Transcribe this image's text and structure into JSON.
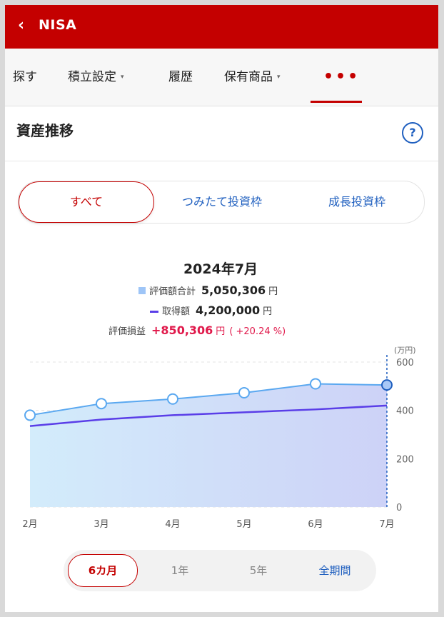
{
  "header": {
    "back_icon": "chevron-left-icon",
    "title": "NISA"
  },
  "nav": {
    "items": [
      {
        "label": "探す"
      },
      {
        "label": "積立設定",
        "caret": "▾"
      },
      {
        "label": "履歴"
      },
      {
        "label": "保有商品",
        "caret": "▾"
      },
      {
        "label": "•••"
      }
    ]
  },
  "section": {
    "title": "資産推移",
    "help_label": "?"
  },
  "segments": [
    "すべて",
    "つみたて投資枠",
    "成長投資枠"
  ],
  "summary": {
    "period": "2024年7月",
    "market_value": {
      "label": "評価額合計",
      "value": "5,050,306",
      "unit": "円"
    },
    "cost": {
      "label": "取得額",
      "value": "4,200,000",
      "unit": "円"
    },
    "profit": {
      "label": "評価損益",
      "value": "+850,306",
      "unit": "円",
      "pct": "( +20.24 %)"
    }
  },
  "chart_data": {
    "type": "area",
    "categories": [
      "2月",
      "3月",
      "4月",
      "5月",
      "6月",
      "7月"
    ],
    "series": [
      {
        "name": "評価額合計",
        "values": [
          380,
          428,
          447,
          473,
          510,
          505
        ],
        "color": "#5aa8f0"
      },
      {
        "name": "取得額",
        "values": [
          335,
          362,
          380,
          392,
          404,
          420
        ],
        "color": "#5a3ee8"
      }
    ],
    "ylabel": "(万円)",
    "yticks": [
      "0",
      "200",
      "400",
      "600"
    ],
    "ylim": [
      0,
      600
    ],
    "grid": true,
    "selected": "7月"
  },
  "range_tabs": [
    "6カ月",
    "1年",
    "5年",
    "全期間"
  ]
}
